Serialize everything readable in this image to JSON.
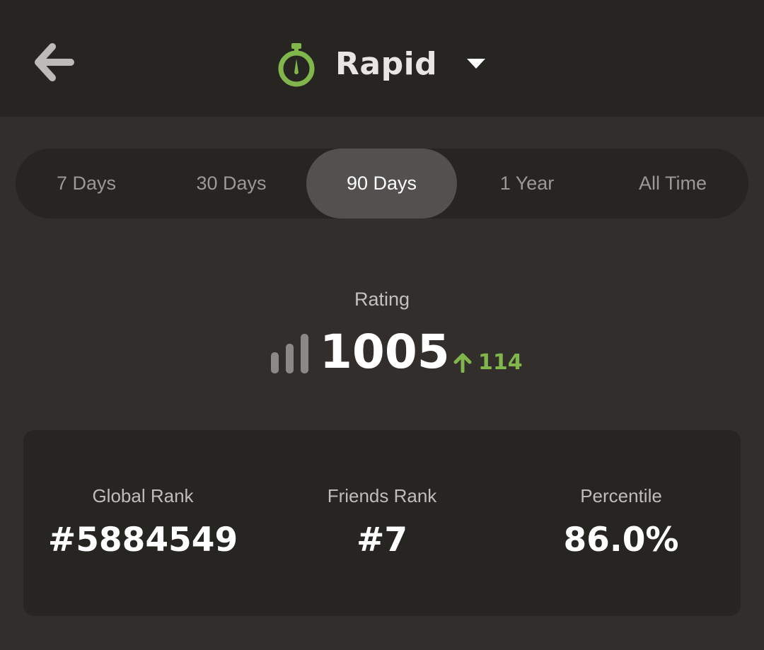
{
  "header": {
    "title": "Rapid",
    "back_icon": "arrow-left-icon",
    "title_icon": "stopwatch-icon",
    "dropdown_icon": "caret-down-icon",
    "accent_color": "#81b64c"
  },
  "tabs": [
    {
      "label": "7 Days",
      "active": false
    },
    {
      "label": "30 Days",
      "active": false
    },
    {
      "label": "90 Days",
      "active": true
    },
    {
      "label": "1 Year",
      "active": false
    },
    {
      "label": "All Time",
      "active": false
    }
  ],
  "rating": {
    "label": "Rating",
    "value": "1005",
    "change": "114",
    "change_direction": "up",
    "change_color": "#81b64c",
    "icon": "bar-chart-icon"
  },
  "stats": [
    {
      "label": "Global Rank",
      "value": "#5884549"
    },
    {
      "label": "Friends Rank",
      "value": "#7"
    },
    {
      "label": "Percentile",
      "value": "86.0%"
    }
  ]
}
